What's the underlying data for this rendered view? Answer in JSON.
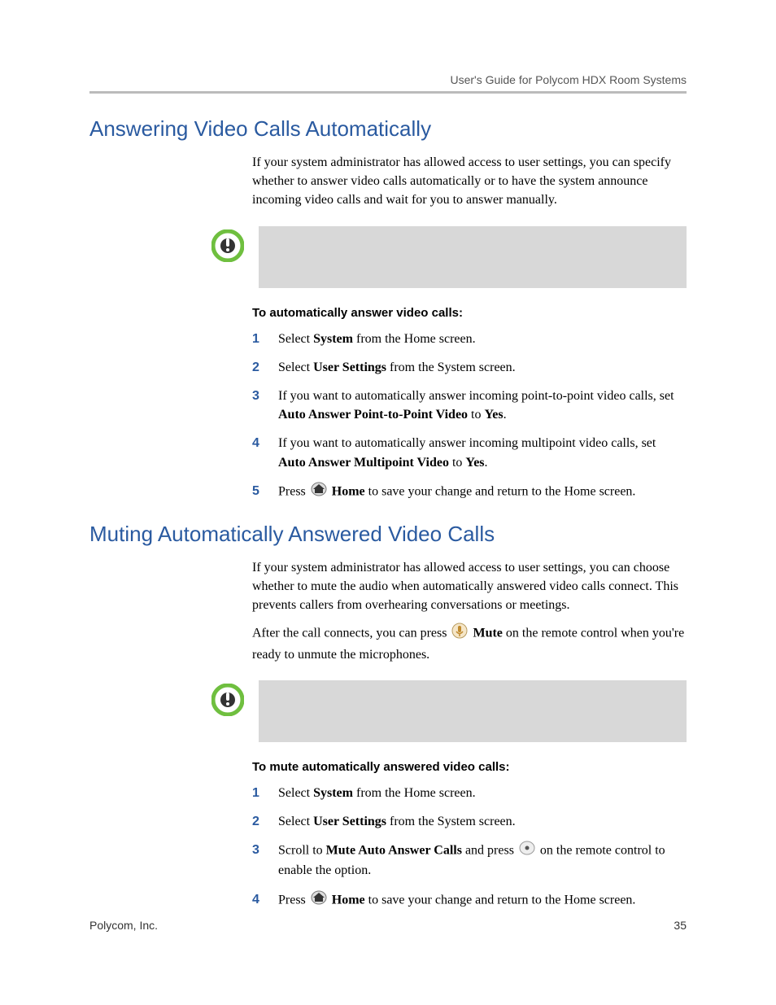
{
  "header": {
    "running_title": "User's Guide for Polycom HDX Room Systems"
  },
  "section1": {
    "heading": "Answering Video Calls Automatically",
    "intro": "If your system administrator has allowed access to user settings, you can specify whether to answer video calls automatically or to have the system announce incoming video calls and wait for you to answer manually.",
    "tip": "",
    "subheading": "To automatically answer video calls:",
    "steps": {
      "s1_a": "Select ",
      "s1_b": "System",
      "s1_c": " from the Home screen.",
      "s2_a": "Select ",
      "s2_b": "User Settings",
      "s2_c": " from the System screen.",
      "s3_a": "If you want to automatically answer incoming point-to-point video calls, set ",
      "s3_b": "Auto Answer Point-to-Point Video",
      "s3_c": " to ",
      "s3_d": "Yes",
      "s3_e": ".",
      "s4_a": "If you want to automatically answer incoming multipoint video calls, set ",
      "s4_b": "Auto Answer Multipoint Video",
      "s4_c": " to ",
      "s4_d": "Yes",
      "s4_e": ".",
      "s5_a": "Press ",
      "s5_b": "Home",
      "s5_c": " to save your change and return to the Home screen."
    }
  },
  "section2": {
    "heading": "Muting Automatically Answered Video Calls",
    "intro": "If your system administrator has allowed access to user settings, you can choose whether to mute the audio when automatically answered video calls connect. This prevents callers from overhearing conversations or meetings.",
    "intro2_a": "After the call connects, you can press ",
    "intro2_b": "Mute",
    "intro2_c": " on the remote control when you're ready to unmute the microphones.",
    "tip": "",
    "subheading": "To mute automatically answered video calls:",
    "steps": {
      "s1_a": "Select ",
      "s1_b": "System",
      "s1_c": " from the Home screen.",
      "s2_a": "Select ",
      "s2_b": "User Settings",
      "s2_c": " from the System screen.",
      "s3_a": "Scroll to ",
      "s3_b": "Mute Auto Answer Calls",
      "s3_c": " and press ",
      "s3_d": " on the remote control to enable the option.",
      "s4_a": "Press ",
      "s4_b": "Home",
      "s4_c": " to save your change and return to the Home screen."
    }
  },
  "footer": {
    "left": "Polycom, Inc.",
    "right": "35"
  }
}
